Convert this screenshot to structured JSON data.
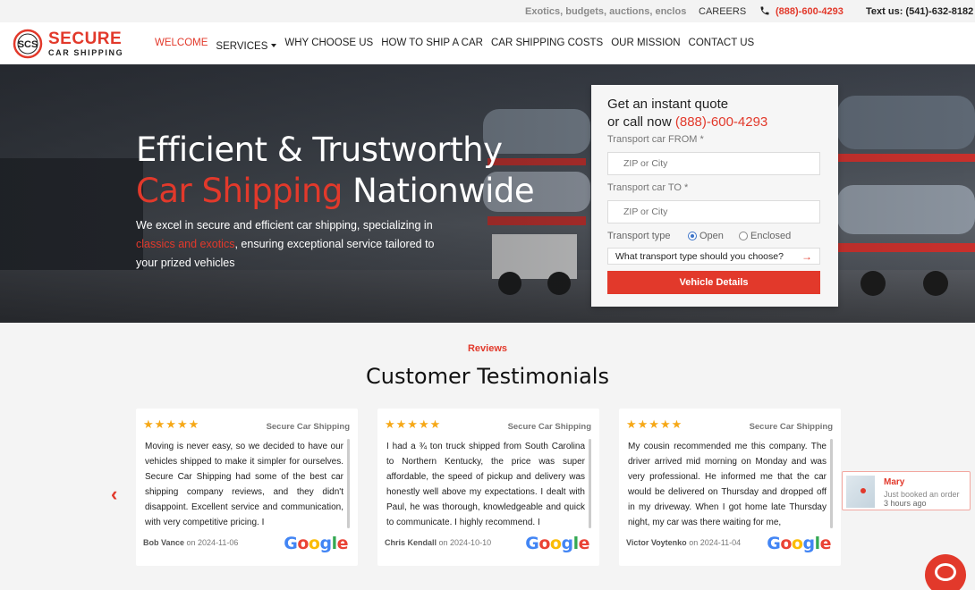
{
  "topbar": {
    "ticker": "Exotics, budgets, auctions, enclosed",
    "careers": "CAREERS",
    "phone": "(888)-600-4293",
    "text_us": "Text us:  (541)-632-8182"
  },
  "logo": {
    "word1": "SECURE",
    "word2": "CAR SHIPPING",
    "mark": "SCS"
  },
  "nav": {
    "items": [
      {
        "label": "WELCOME"
      },
      {
        "label": "SERVICES"
      },
      {
        "label": "WHY CHOOSE US"
      },
      {
        "label": "HOW TO SHIP A CAR"
      },
      {
        "label": "CAR SHIPPING COSTS"
      },
      {
        "label": "OUR MISSION"
      },
      {
        "label": "CONTACT US"
      }
    ]
  },
  "hero": {
    "line1": "Efficient & Trustworthy",
    "line2_red": "Car Shipping",
    "line2_rest": " Nationwide",
    "lead_a": "We excel in secure and efficient car shipping, specializing in ",
    "lead_red": "classics and exotics",
    "lead_b": ", ensuring exceptional service tailored to your prized vehicles"
  },
  "quote": {
    "heading1": "Get an instant quote",
    "heading2_a": "or call now ",
    "heading2_phone": "(888)-600-4293",
    "from_label": "Transport car FROM *",
    "from_placeholder": "ZIP or City",
    "to_label": "Transport car TO *",
    "to_placeholder": "ZIP or City",
    "type_label": "Transport type",
    "option_open": "Open",
    "option_enclosed": "Enclosed",
    "selected_type": "Open",
    "help_text": "What transport type should you choose?",
    "cta": "Vehicle Details"
  },
  "reviews": {
    "eyebrow": "Reviews",
    "title": "Customer Testimonials",
    "items": [
      {
        "stars": "★★★★★",
        "source": "Secure Car Shipping",
        "text": "Moving is never easy, so we decided to have our vehicles shipped to make it simpler for ourselves. Secure Car Shipping had some of the best car shipping company reviews, and they didn't disappoint. Excellent service and communication, with very competitive pricing. I",
        "author": "Bob Vance",
        "date": "on 2024-11-06"
      },
      {
        "stars": "★★★★★",
        "source": "Secure Car Shipping",
        "text": "I had a ¾ ton truck shipped from South Carolina to Northern Kentucky, the price was super affordable, the speed of pickup and delivery was honestly well above my expectations. I dealt with Paul, he was thorough, knowledgeable and quick to communicate. I highly recommend. I",
        "author": "Chris Kendall",
        "date": "on 2024-10-10"
      },
      {
        "stars": "★★★★★",
        "source": "Secure Car Shipping",
        "text": "My cousin recommended me this company. The driver arrived mid morning on Monday and was very professional. He informed me that the car would be delivered on Thursday and dropped off in my driveway. When I got home late Thursday night, my car was there waiting for me,",
        "author": "Victor Voytenko",
        "date": "on 2024-11-04"
      }
    ],
    "google": [
      "G",
      "o",
      "o",
      "g",
      "l",
      "e"
    ]
  },
  "popup": {
    "name": "Mary",
    "message": "Just booked an order",
    "time": "3 hours ago"
  },
  "colors": {
    "accent": "#e2392b",
    "star": "#f6a817"
  }
}
